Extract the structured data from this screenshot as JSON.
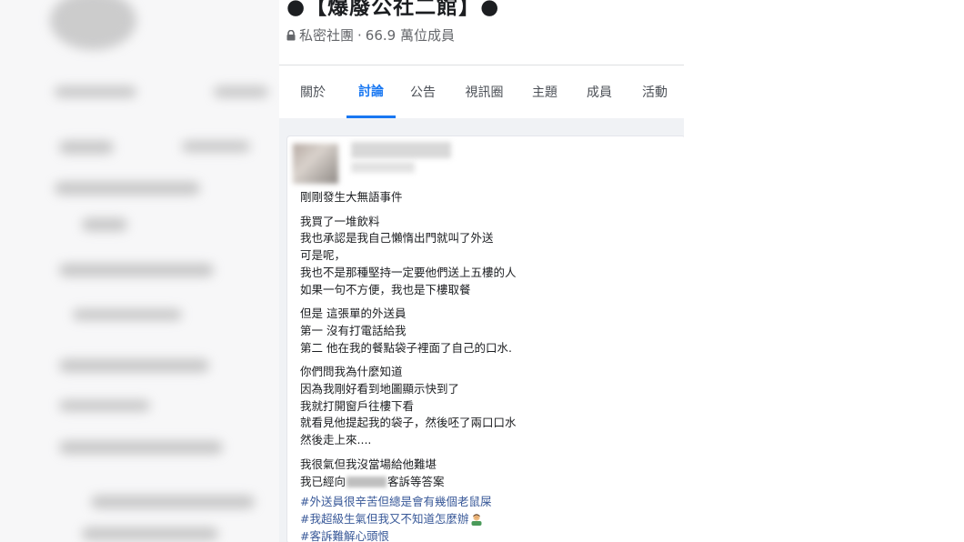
{
  "group": {
    "title": "●【爆廢公社二館】●",
    "privacy": "私密社團",
    "sep": " · ",
    "members": "66.9 萬位成員"
  },
  "tabs": [
    {
      "label": "關於"
    },
    {
      "label": "討論"
    },
    {
      "label": "公告"
    },
    {
      "label": "視訊圈"
    },
    {
      "label": "主題"
    },
    {
      "label": "成員"
    },
    {
      "label": "活動"
    }
  ],
  "active_tab": "討論",
  "post": {
    "headline": "剛剛發生大無語事件",
    "paragraphs": [
      [
        "我買了一堆飲料",
        "我也承認是我自己懶惰出門就叫了外送",
        "可是呢，",
        "我也不是那種堅持一定要他們送上五樓的人",
        "如果一句不方便，我也是下樓取餐"
      ],
      [
        "但是 這張單的外送員",
        "第一 沒有打電話給我",
        "第二 他在我的餐點袋子裡面了自己的口水."
      ],
      [
        "你們問我為什麼知道",
        "因為我剛好看到地圖顯示快到了",
        "我就打開窗戶往樓下看",
        "就看見他提起我的袋子，然後呸了兩口口水",
        "然後走上來...."
      ]
    ],
    "final_line1": "我很氣但我沒當場給他難堪",
    "final_line2_prefix": "我已經向",
    "final_line2_suffix": "客訴等答案",
    "hashtags": [
      "#外送員很辛苦但總是會有幾個老鼠屎",
      "#我超級生氣但我又不知道怎麼辦",
      "#客訴難解心頭恨"
    ]
  },
  "colors": {
    "accent": "#1877f2",
    "hashtag": "#385898",
    "meta": "#65676b"
  },
  "icons": {
    "privacy": "lock-icon",
    "emoji": "man-facepalming-emoji"
  }
}
